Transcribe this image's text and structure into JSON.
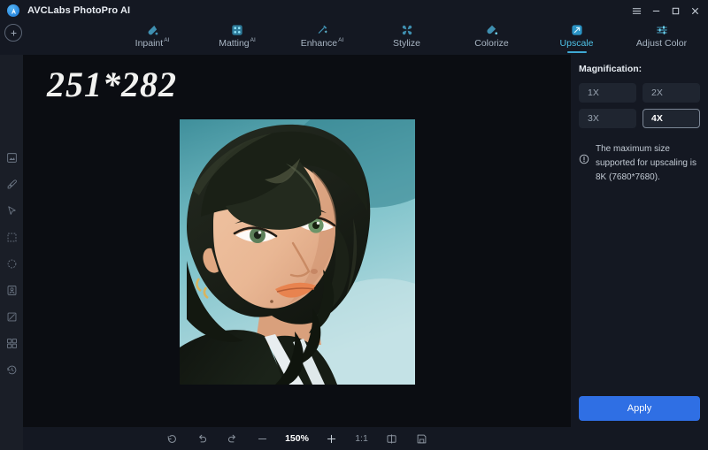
{
  "titlebar": {
    "app_name": "AVCLabs PhotoPro AI",
    "logo_icon": "app-logo-icon",
    "menu_icon": "hamburger-menu-icon",
    "minimize_icon": "minimize-icon",
    "maximize_icon": "maximize-icon",
    "close_icon": "close-icon"
  },
  "topnav": {
    "add_button_icon": "add-circle-icon",
    "items": [
      {
        "label": "Inpaint",
        "badge": "AI",
        "icon": "inpaint-icon",
        "active": false
      },
      {
        "label": "Matting",
        "badge": "AI",
        "icon": "matting-icon",
        "active": false
      },
      {
        "label": "Enhance",
        "badge": "AI",
        "icon": "enhance-icon",
        "active": false
      },
      {
        "label": "Stylize",
        "badge": "",
        "icon": "stylize-icon",
        "active": false
      },
      {
        "label": "Colorize",
        "badge": "",
        "icon": "colorize-icon",
        "active": false
      },
      {
        "label": "Upscale",
        "badge": "",
        "icon": "upscale-icon",
        "active": true
      },
      {
        "label": "Adjust Color",
        "badge": "",
        "icon": "adjust-color-icon",
        "active": false
      }
    ]
  },
  "rail": {
    "items": [
      {
        "icon": "image-tool-icon"
      },
      {
        "icon": "brush-tool-icon"
      },
      {
        "icon": "cursor-tool-icon"
      },
      {
        "icon": "rect-select-tool-icon"
      },
      {
        "icon": "ellipse-select-tool-icon"
      },
      {
        "icon": "portrait-tool-icon"
      },
      {
        "icon": "eraser-tool-icon"
      },
      {
        "icon": "layers-tool-icon"
      },
      {
        "icon": "history-tool-icon"
      }
    ]
  },
  "canvas": {
    "dimensions_overlay": "251*282",
    "image_alt": "portrait-photo"
  },
  "bottombar": {
    "items": [
      {
        "name": "reset-button",
        "icon": "reset-icon",
        "label": ""
      },
      {
        "name": "undo-button",
        "icon": "undo-icon",
        "label": ""
      },
      {
        "name": "redo-button",
        "icon": "redo-icon",
        "label": ""
      },
      {
        "name": "zoom-out-button",
        "icon": "minus-icon",
        "label": ""
      },
      {
        "name": "zoom-level",
        "icon": "",
        "label": "150%"
      },
      {
        "name": "zoom-in-button",
        "icon": "plus-icon",
        "label": ""
      },
      {
        "name": "actual-size-button",
        "icon": "",
        "label": "1:1"
      },
      {
        "name": "compare-button",
        "icon": "compare-split-icon",
        "label": ""
      },
      {
        "name": "save-button",
        "icon": "save-disk-icon",
        "label": ""
      }
    ],
    "zoom_level": "150%",
    "actual_size": "1:1"
  },
  "panel": {
    "title": "Magnification:",
    "options": [
      {
        "label": "1X",
        "selected": false
      },
      {
        "label": "2X",
        "selected": false
      },
      {
        "label": "3X",
        "selected": false
      },
      {
        "label": "4X",
        "selected": true
      }
    ],
    "hint_icon": "info-circle-icon",
    "hint_text": "The maximum size supported for upscaling is 8K (7680*7680).",
    "apply_label": "Apply"
  },
  "colors": {
    "accent": "#4fc3e8",
    "apply_blue": "#2f6fe4",
    "panel_bg": "#141822",
    "canvas_bg": "#0b0d12",
    "rail_bg": "#1a1e27"
  }
}
